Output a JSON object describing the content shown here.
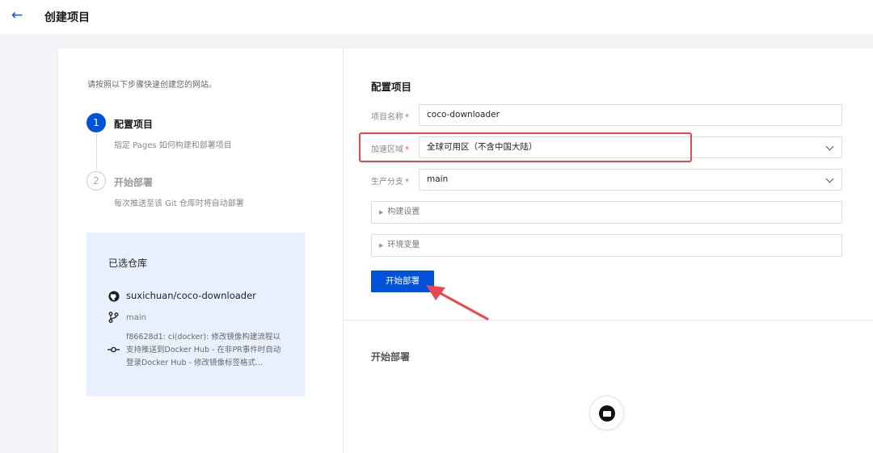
{
  "header": {
    "back_icon": "←",
    "title": "创建项目"
  },
  "sidebar": {
    "intro": "请按照以下步骤快速创建您的网站。",
    "steps": [
      {
        "num": "1",
        "title": "配置项目",
        "desc": "指定 Pages 如何构建和部署项目",
        "state": "active"
      },
      {
        "num": "2",
        "title": "开始部署",
        "desc": "每次推送至该 Git 仓库时将自动部署",
        "state": "pending"
      }
    ],
    "repo": {
      "heading": "已选仓库",
      "name": "suxichuan/coco-downloader",
      "branch": "main",
      "commit": "f86628d1: ci(docker): 修改镜像构建流程以支持推送到Docker Hub - 在非PR事件时自动登录Docker Hub - 修改镜像标签格式..."
    }
  },
  "config": {
    "title": "配置项目",
    "fields": {
      "name": {
        "label": "项目名称",
        "required": "*",
        "value": "coco-downloader"
      },
      "region": {
        "label": "加速区域",
        "required": "*",
        "value": "全球可用区（不含中国大陆）"
      },
      "branch": {
        "label": "生产分支",
        "required": "*",
        "value": "main"
      }
    },
    "collapsibles": {
      "build": "构建设置",
      "env": "环境变量"
    },
    "submit_label": "开始部署"
  },
  "deploy": {
    "title": "开始部署"
  },
  "colors": {
    "primary": "#0052d9",
    "highlight": "#e8474f",
    "required": "#e34d59",
    "repo_bg": "#e8f0fd"
  },
  "icons": {
    "back": "arrow-left-icon",
    "github": "github-icon",
    "branch": "git-branch-icon",
    "commit": "git-commit-icon",
    "select": "chevron-down-icon",
    "expand": "caret-right-icon",
    "loader": "loading-icon"
  }
}
